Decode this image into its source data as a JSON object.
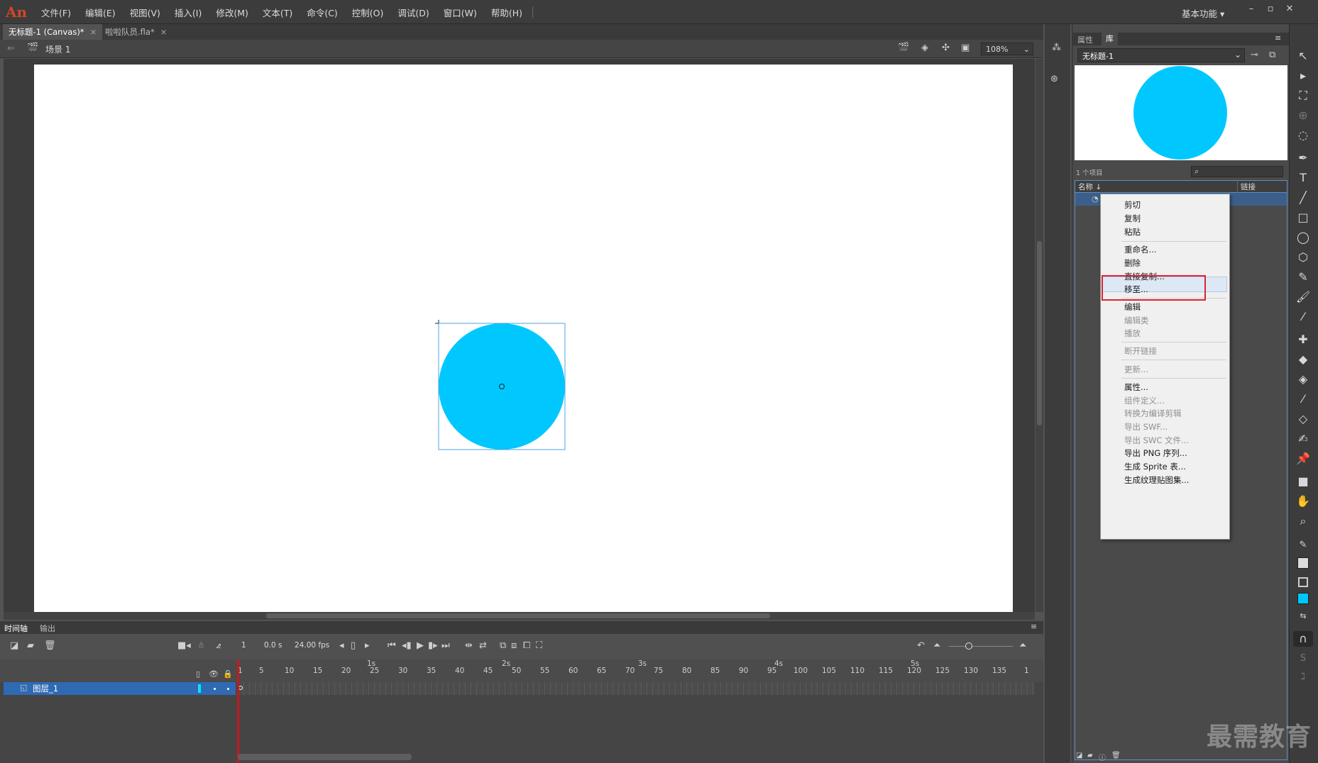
{
  "app": {
    "logo": "An"
  },
  "menu": [
    "文件(F)",
    "编辑(E)",
    "视图(V)",
    "插入(I)",
    "修改(M)",
    "文本(T)",
    "命令(C)",
    "控制(O)",
    "调试(D)",
    "窗口(W)",
    "帮助(H)"
  ],
  "workspace": "基本功能",
  "doc_tabs": [
    {
      "label": "无标题-1 (Canvas)*",
      "close": "×"
    },
    {
      "label": "啦啦队员.fla*",
      "close": "×"
    }
  ],
  "scene": {
    "name": "场景 1",
    "zoom": "108%"
  },
  "stage": {
    "circle_color": "#00c8ff"
  },
  "timeline": {
    "tabs": [
      "时间轴",
      "输出"
    ],
    "frame": "1",
    "time": "0.0 s",
    "fps": "24.00 fps",
    "seconds": [
      "1s",
      "2s",
      "3s",
      "4s",
      "5s"
    ],
    "ticks": [
      "1",
      "5",
      "10",
      "15",
      "20",
      "25",
      "30",
      "35",
      "40",
      "45",
      "50",
      "55",
      "60",
      "65",
      "70",
      "75",
      "80",
      "85",
      "90",
      "95",
      "100",
      "105",
      "110",
      "115",
      "120",
      "125",
      "130",
      "135",
      "1"
    ],
    "layer_name": "图层_1"
  },
  "library": {
    "tabs": [
      "属性",
      "库"
    ],
    "doc_name": "无标题-1",
    "item_count": "1 个项目",
    "col_name": "名称",
    "col_link": "链接",
    "preview_color": "#00c8ff"
  },
  "context_menu": {
    "groups": [
      [
        {
          "label": "剪切",
          "enabled": true
        },
        {
          "label": "复制",
          "enabled": true
        },
        {
          "label": "粘贴",
          "enabled": true
        }
      ],
      [
        {
          "label": "重命名...",
          "enabled": true
        },
        {
          "label": "删除",
          "enabled": true
        },
        {
          "label": "直接复制...",
          "enabled": true
        },
        {
          "label": "移至...",
          "enabled": true
        }
      ],
      [
        {
          "label": "编辑",
          "enabled": true
        },
        {
          "label": "编辑类",
          "enabled": false
        },
        {
          "label": "播放",
          "enabled": false
        }
      ],
      [
        {
          "label": "断开链接",
          "enabled": false
        }
      ],
      [
        {
          "label": "更新...",
          "enabled": false
        }
      ],
      [
        {
          "label": "属性...",
          "enabled": true
        },
        {
          "label": "组件定义...",
          "enabled": false
        },
        {
          "label": "转换为编译剪辑",
          "enabled": false
        },
        {
          "label": "导出 SWF...",
          "enabled": false
        },
        {
          "label": "导出 SWC 文件...",
          "enabled": false
        },
        {
          "label": "导出 PNG 序列...",
          "enabled": true
        },
        {
          "label": "生成 Sprite 表...",
          "enabled": true
        },
        {
          "label": "生成纹理贴图集...",
          "enabled": true
        }
      ]
    ],
    "highlighted": "直接复制..."
  },
  "watermark": "最需教育",
  "colors": {
    "stroke": "#dcdcdc",
    "fill": "#00c8ff",
    "accent_red": "#e0232f"
  }
}
